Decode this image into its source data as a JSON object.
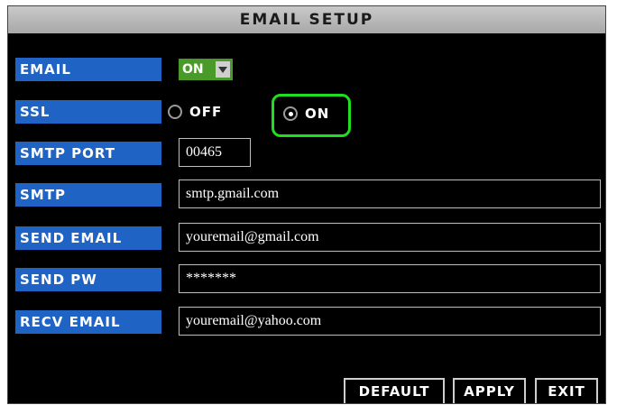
{
  "window": {
    "title": "EMAIL SETUP"
  },
  "labels": {
    "email": "EMAIL",
    "ssl": "SSL",
    "smtp_port": "SMTP PORT",
    "smtp": "SMTP",
    "send_email": "SEND EMAIL",
    "send_pw": "SEND PW",
    "recv_email": "RECV EMAIL"
  },
  "email_toggle": {
    "value": "ON"
  },
  "ssl_options": {
    "off": "OFF",
    "on": "ON",
    "selected": "ON"
  },
  "fields": {
    "smtp_port": "00465",
    "smtp": "smtp.gmail.com",
    "send_email": "youremail@gmail.com",
    "send_pw": "*******",
    "recv_email": "youremail@yahoo.com"
  },
  "buttons": {
    "default": "DEFAULT",
    "apply": "APPLY",
    "exit": "EXIT"
  },
  "colors": {
    "label_bg": "#1f63c4",
    "highlight": "#1ee01e",
    "toggle_bg": "#4a9a2a"
  },
  "icons": {
    "dropdown": "chevron-down-icon",
    "radio": "radio-icon"
  }
}
